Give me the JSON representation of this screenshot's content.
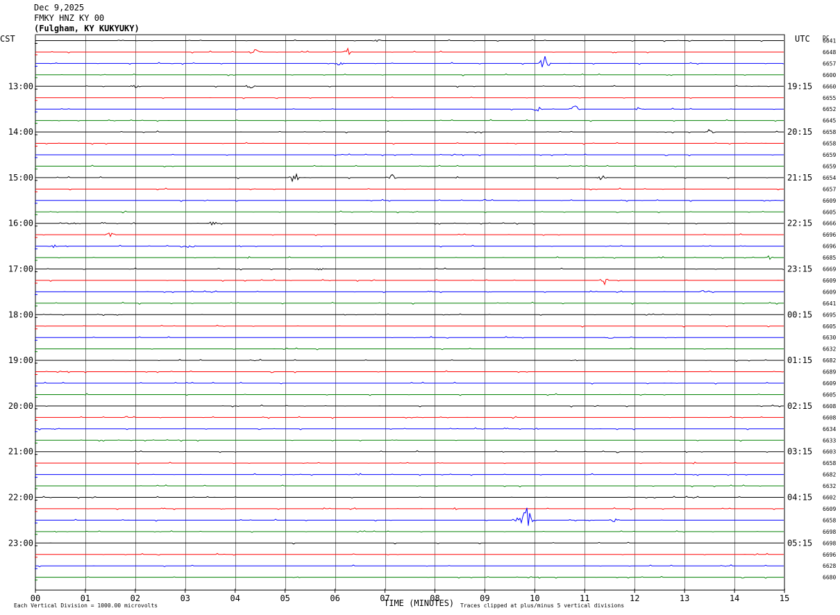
{
  "header": {
    "date": "Dec 9,2025",
    "station": "FMKY HNZ KY 00",
    "location": "(Fulgham, KY KUKYUKY)"
  },
  "labels": {
    "left_tz": "CST",
    "right_tz": "UTC",
    "dc_label": "DC",
    "xlabel": "TIME (MINUTES)",
    "scale_note": "Each Vertical Division = 1000.00 microvolts",
    "clip_note": "Traces clipped at plus/minus 5 vertical divisions"
  },
  "colors": {
    "black": "#000000",
    "red": "#ff0000",
    "blue": "#0000ff",
    "green": "#008000",
    "grid": "#808080"
  },
  "chart_data": {
    "type": "line",
    "title": "",
    "xlabel": "TIME (MINUTES)",
    "xlim": [
      0,
      15
    ],
    "x_ticks": [
      "00",
      "01",
      "02",
      "03",
      "04",
      "05",
      "06",
      "07",
      "08",
      "09",
      "10",
      "11",
      "12",
      "13",
      "14",
      "15"
    ],
    "left_hour_labels": [
      "13:00",
      "14:00",
      "15:00",
      "16:00",
      "17:00",
      "18:00",
      "19:00",
      "20:00",
      "21:00",
      "22:00",
      "23:00"
    ],
    "right_hour_labels": [
      "19:15",
      "20:15",
      "21:15",
      "22:15",
      "23:15",
      "00:15",
      "01:15",
      "02:15",
      "03:15",
      "04:15",
      "05:15"
    ],
    "trace_count": 48,
    "trace_color_cycle": [
      "black",
      "red",
      "blue",
      "green"
    ],
    "dc_offsets": [
      "6641",
      "6648",
      "6657",
      "6600",
      "6660",
      "6655",
      "6652",
      "6645",
      "6658",
      "6658",
      "6659",
      "6659",
      "6654",
      "6657",
      "6609",
      "6605",
      "6666",
      "6696",
      "6696",
      "6685",
      "6669",
      "6609",
      "6609",
      "6641",
      "6695",
      "6605",
      "6630",
      "6632",
      "6682",
      "6689",
      "6609",
      "6605",
      "6608",
      "6608",
      "6634",
      "6633",
      "6603",
      "6658",
      "6682",
      "6632",
      "6602",
      "6609",
      "6658",
      "6698",
      "6698",
      "6696",
      "6628",
      "6680"
    ],
    "events": [
      {
        "trace": 0,
        "minute": 6.85,
        "amp": 2
      },
      {
        "trace": 1,
        "minute": 4.38,
        "amp": 5
      },
      {
        "trace": 1,
        "minute": 6.25,
        "amp": 6
      },
      {
        "trace": 2,
        "minute": 10.2,
        "amp": 14
      },
      {
        "trace": 2,
        "minute": 6.1,
        "amp": 5
      },
      {
        "trace": 4,
        "minute": 2.0,
        "amp": 3
      },
      {
        "trace": 4,
        "minute": 4.3,
        "amp": 3
      },
      {
        "trace": 6,
        "minute": 10.05,
        "amp": 5
      },
      {
        "trace": 6,
        "minute": 10.8,
        "amp": 6
      },
      {
        "trace": 6,
        "minute": 12.1,
        "amp": 3
      },
      {
        "trace": 8,
        "minute": 13.5,
        "amp": 4
      },
      {
        "trace": 12,
        "minute": 5.18,
        "amp": 9
      },
      {
        "trace": 12,
        "minute": 7.12,
        "amp": 6
      },
      {
        "trace": 12,
        "minute": 11.35,
        "amp": 5
      },
      {
        "trace": 16,
        "minute": 0.7,
        "amp": 2
      },
      {
        "trace": 16,
        "minute": 3.55,
        "amp": 3
      },
      {
        "trace": 17,
        "minute": 1.5,
        "amp": 4
      },
      {
        "trace": 18,
        "minute": 0.35,
        "amp": 3
      },
      {
        "trace": 18,
        "minute": 3.1,
        "amp": 3
      },
      {
        "trace": 19,
        "minute": 14.7,
        "amp": 3
      },
      {
        "trace": 20,
        "minute": 5.7,
        "amp": 2
      },
      {
        "trace": 21,
        "minute": 11.4,
        "amp": 8
      },
      {
        "trace": 22,
        "minute": 13.4,
        "amp": 4
      },
      {
        "trace": 26,
        "minute": 11.5,
        "amp": 2
      },
      {
        "trace": 42,
        "minute": 9.85,
        "amp": 20
      },
      {
        "trace": 42,
        "minute": 9.72,
        "amp": 8
      },
      {
        "trace": 42,
        "minute": 11.6,
        "amp": 4
      }
    ]
  }
}
